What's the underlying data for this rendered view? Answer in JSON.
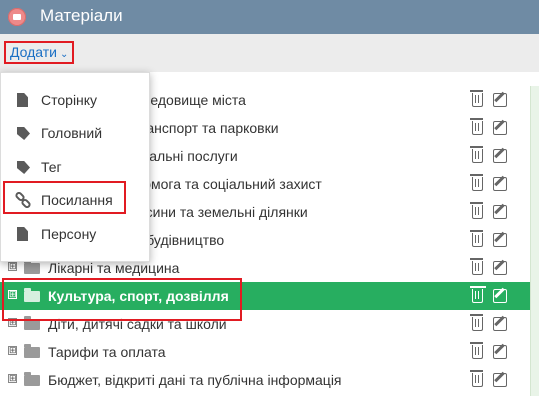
{
  "header": {
    "title": "Матеріали",
    "bg": "#6f8ba4"
  },
  "toolbar": {
    "add_label": "Додати",
    "add_chevron": "⌄"
  },
  "menu": {
    "items": [
      {
        "label": "Сторінку",
        "icon": "document-icon"
      },
      {
        "label": "Головний",
        "icon": "tag-icon"
      },
      {
        "label": "Тег",
        "icon": "tag-icon"
      },
      {
        "label": "Посилання",
        "icon": "link-icon"
      },
      {
        "label": "Персону",
        "icon": "document-icon"
      }
    ]
  },
  "tree": {
    "rows": [
      {
        "label": "Довкілля та середовище міста",
        "expander": "⊞",
        "selected": false
      },
      {
        "label": "Благоустрій, транспорт та парковки",
        "expander": "⊞",
        "selected": false
      },
      {
        "label": "Житлово-комунальні послуги",
        "expander": "⊞",
        "selected": false
      },
      {
        "label": "Соціальна допомога та соціальний захист",
        "expander": "⊞",
        "selected": false
      },
      {
        "label": "Земельні відносини та земельні ділянки",
        "expander": "⊞",
        "selected": false
      },
      {
        "label": "Архітектура та будівництво",
        "expander": "⊞",
        "selected": false
      },
      {
        "label": "Лікарні та медицина",
        "expander": "⊞",
        "selected": false
      },
      {
        "label": "Культура, спорт, дозвілля",
        "expander": "⊞",
        "selected": true
      },
      {
        "label": "Діти, дитячі садки та школи",
        "expander": "⊞",
        "selected": false
      },
      {
        "label": "Тарифи та оплата",
        "expander": "⊞",
        "selected": false
      },
      {
        "label": "Бюджет, відкриті дані та публічна інформація",
        "expander": "⊞",
        "selected": false
      }
    ]
  },
  "colors": {
    "selected_row": "#27ae60",
    "highlight": "#e11b22",
    "link": "#1a6fc4"
  }
}
